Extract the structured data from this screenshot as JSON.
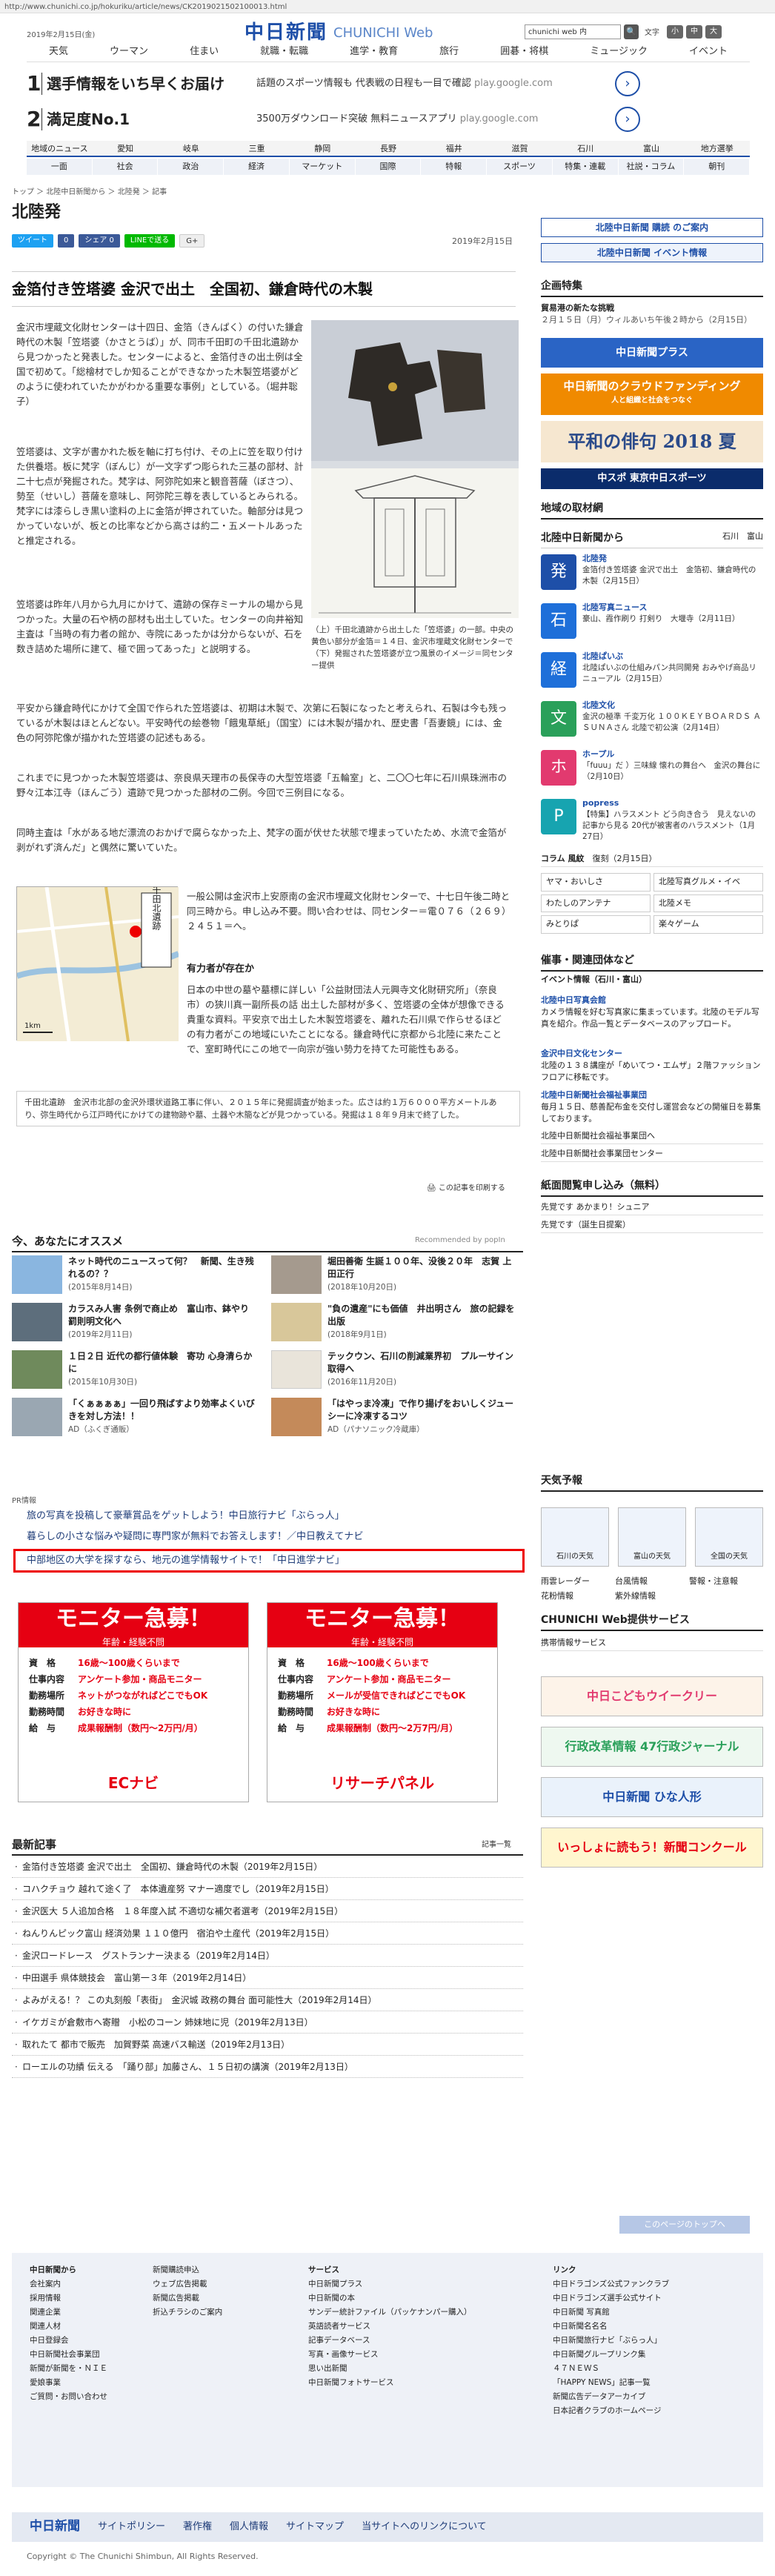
{
  "url": "http://www.chunichi.co.jp/hokuriku/article/news/CK2019021502100013.html",
  "top_date": "2019年2月15日(金)",
  "logo": {
    "main": "中日新聞",
    "sub": "CHUNICHI Web"
  },
  "search": {
    "value": "chunichi web 内",
    "button": "🔍"
  },
  "font_size": {
    "label": "文字",
    "btn_small": "小",
    "btn_mid": "中",
    "btn_large": "大"
  },
  "topnav": [
    "天気",
    "ウーマン",
    "住まい",
    "就職・転職",
    "進学・教育",
    "旅行",
    "囲碁・将棋",
    "ミュージック",
    "イベント"
  ],
  "ads": [
    {
      "num": "1",
      "title": "選手情報をいち早くお届け",
      "desc": "話題のスポーツ情報も 代表戦の日程も一目で確認",
      "src": "play.google.com"
    },
    {
      "num": "2",
      "title": "満足度No.1",
      "desc": "3500万ダウンロード突破 無料ニュースアプリ",
      "src": "play.google.com"
    }
  ],
  "regnav": [
    "地域のニュース",
    "愛知",
    "岐阜",
    "三重",
    "静岡",
    "長野",
    "福井",
    "滋賀",
    "石川",
    "富山",
    "地方選挙"
  ],
  "catnav": [
    "一面",
    "社会",
    "政治",
    "経済",
    "マーケット",
    "国際",
    "特報",
    "スポーツ",
    "特集・連載",
    "社説・コラム",
    "朝刊"
  ],
  "breadcrumb": "トップ ＞ 北陸中日新聞から ＞ 北陸発 ＞ 記事",
  "section_title": "北陸発",
  "share": {
    "tweet": "ツイート",
    "like": "0",
    "share": "シェア 0",
    "line": "LINEで送る",
    "gplus": "G+"
  },
  "article_date": "2019年2月15日",
  "headline": "金箔付き笠塔婆 金沢で出土　全国初、鎌倉時代の木製",
  "paragraphs": [
    "金沢市埋蔵文化財センターは十四日、金箔（きんぱく）の付いた鎌倉時代の木製「笠塔婆（かさとうば）」が、同市千田町の千田北遺跡から見つかったと発表した。センターによると、金箔付きの出土例は全国で初めて。「総檜材でしか知ることができなかった木製笠塔婆がどのように使われていたかがわかる重要な事例」としている。（堀井聡子）",
    "笠塔婆は、文字が書かれた板を軸に打ち付け、その上に笠を取り付けた供養塔。板に梵字（ぼんじ）が一文字ずつ彫られた三基の部材、計二十七点が発掘された。梵字は、阿弥陀如来と観音菩薩（ぼさつ）、勢至（せいし）菩薩を意味し、阿弥陀三尊を表しているとみられる。梵字には漆らしき黒い塗料の上に金箔が押されていた。軸部分は見つかっていないが、板との比率などから高さは約二・五メートルあったと推定される。",
    "笠塔婆は昨年八月から九月にかけて、遺跡の保存ミーナルの場から見つかった。大量の石や柄の部材も出土していた。センターの向井裕知主査は「当時の有力者の館か、寺院にあったかは分からないが、石を数き詰めた場所に建て、極で囲ってあった」と説明する。",
    "平安から鎌倉時代にかけて全国で作られた笠塔婆は、初期は木製で、次第に石製になったと考えられ、石製は今も残っているが木製はほとんどない。平安時代の絵巻物「餓鬼草紙」（国宝）には木製が描かれ、歴史書「吾妻鏡」には、金色の阿弥陀像が描かれた笠塔婆の記述もある。",
    "これまでに見つかった木製笠塔婆は、奈良県天理市の長保寺の大型笠塔婆「五輪室」と、二〇〇七年に石川県珠洲市の野々江本江寺（ほんごう）遺跡で見つかった部材の二例。今回で三例目になる。",
    "同時主査は「水がある地だ漂流のおかげで腐らなかった上、梵字の面が伏せた状態で埋まっていたため、水流で金箔が剥がれず済んだ」と偶然に驚いていた。"
  ],
  "caption": "（上）千田北遺跡から出土した「笠塔婆」の一部。中央の黄色い部分が金箔＝１４日、金沢市埋蔵文化財センターで（下）発掘された笠塔婆が立つ風景のイメージ＝同センター提供",
  "map": {
    "label": "千田北遺跡",
    "scale": "1km"
  },
  "exhibit": "一般公開は金沢市上安原南の金沢市埋蔵文化財センターで、十七日午後二時と同三時から。申し込み不要。問い合わせは、同センター＝電０７６（２６９）２４５１＝へ。",
  "expert_title": "有力者が存在か",
  "expert": "日本の中世の墓や墓標に詳しい「公益財団法人元興寺文化財研究所」（奈良市）の狭川真一副所長の話 出土した部材が多く、笠塔婆の全体が想像できる貴重な資料。平安京で出土した木製笠塔婆を、離れた石川県で作らせるほどの有力者がこの地域にいたことになる。鎌倉時代に京都から北陸に来たことで、室町時代にこの地で一向宗が強い勢力を持てた可能性もある。",
  "note": "千田北遺跡　金沢市北部の金沢外環状道路工事に伴い、２０１５年に発掘調査が始まった。広さは約１万６０００平方メートルあり、弥生時代から江戸時代にかけての建物跡や墓、土器や木簡などが見つかっている。発掘は１８年９月末で終了した。",
  "clip": "この記事を印刷する",
  "recommend": {
    "title": "今、あなたにオススメ",
    "poplin": "Recommended by popIn",
    "items": [
      {
        "text": "ネット時代のニュースって何？　新聞、生き残れるの？？",
        "date": "(2015年8月14日)"
      },
      {
        "text": "堀田善衛 生誕１００年、没後２０年　志賀 上田正行",
        "date": "(2018年10月20日)"
      },
      {
        "text": "カラスみ人害 条例で商止め　富山市、鉢やり 罰則明文化へ",
        "date": "(2019年2月11日)"
      },
      {
        "text": "\"負の遺産\"にも価値　井出明さん　旅の記録を出版",
        "date": "(2018年9月1日)"
      },
      {
        "text": "１日２日 近代の都行値体験　寄功 心身清らかに",
        "date": "(2015年10月30日)"
      },
      {
        "text": "テックウン、石川の削減業界初　プルーサイン取得へ",
        "date": "(2016年11月20日)"
      },
      {
        "text": "「くぁぁぁぁ」一回り飛ばすより効率よくいびきを対し方法！！",
        "date": "AD（ふくぎ通販）"
      },
      {
        "text": "「はやっま冷凍」で作り揚げをおいしくジューシーに冷凍するコツ",
        "date": "AD（パナソニック冷蔵庫）"
      }
    ]
  },
  "pr": {
    "label": "PR情報",
    "items": [
      "旅の写真を投稿して豪華賞品をゲットしよう！中日旅行ナビ「ぶらっ人」",
      "暮らしの小さな悩みや疑問に専門家が無料でお答えします！／中日教えてナビ",
      "中部地区の大学を探すなら、地元の進学情報サイトで！「中日進学ナビ」"
    ]
  },
  "monitors": [
    {
      "head": "モニター急募！",
      "sub": "年齢・経験不問",
      "r1k": "資　格",
      "r1v": "16歳〜100歳くらいまで",
      "r2k": "仕事内容",
      "r2v": "アンケート参加・商品モニター",
      "r3k": "勤務場所",
      "r3v": "ネットがつながればどこでもOK",
      "r4k": "勤務時間",
      "r4v": "お好きな時に",
      "r5k": "給　与",
      "r5v": "成果報酬制（数円〜2万円/月）",
      "brand": "ECナビ"
    },
    {
      "head": "モニター急募！",
      "sub": "年齢・経験不問",
      "r1k": "資　格",
      "r1v": "16歳〜100歳くらいまで",
      "r2k": "仕事内容",
      "r2v": "アンケート参加・商品モニター",
      "r3k": "勤務場所",
      "r3v": "メールが受信できればどこでもOK",
      "r4k": "勤務時間",
      "r4v": "お好きな時に",
      "r5k": "給　与",
      "r5v": "成果報酬制（数円〜2万7円/月）",
      "brand": "リサーチパネル"
    }
  ],
  "latest": {
    "title": "最新記事",
    "list_link": "記事一覧",
    "items": [
      "金箔付き笠塔婆 金沢で出土　全国初、鎌倉時代の木製（2019年2月15日）",
      "コハクチョウ 越れて途く了　本体遺産努 マナー適度でし（2019年2月15日）",
      "金沢医大 ５人追加合格　１８年度入試 不適切な補欠者選考（2019年2月15日）",
      "ねんりんピック富山 経済効果 １１０億円　宿泊や土産代（2019年2月15日）",
      "金沢ロードレース　グストランナー決まる（2019年2月14日）",
      "中田選手 県体競技会　富山第一３年（2019年2月14日）",
      "よみがえる！？ この丸刻般「表街」　金沢城 政務の舞台 面可能性大（2019年2月14日）",
      "イケガミが倉敷市へ寄贈　小松のコーン 姉妹地に児（2019年2月13日）",
      "取れたて 都市で販売　加賀野菜 高速バス輸送（2019年2月13日）",
      "ローエルの功績 伝える　「踊り部」加藤さん、１５日初の講演（2019年2月13日）"
    ]
  },
  "side": {
    "subscribe": "北陸中日新聞 購読 のご案内",
    "event": "北陸中日新聞 イベント情報",
    "kikaku_title": "企画特集",
    "kikaku1_title": "貿易港の新たな挑戦",
    "kikaku1_date": "２月１５日（月）ウィルあいち午後２時から（2月15日）",
    "cf_banner": "中日新聞のクラウドファンディング",
    "cf_sub": "人と組織と社会をつなぐ",
    "haiku_banner": "平和の俳句 2018 夏",
    "chusupo": "中スポ 東京中日スポーツ",
    "local_title": "地域の取材網",
    "hokuriku_from": "北陸中日新聞から",
    "hokuriku_links": "石川　富山",
    "news": [
      {
        "icon": "発",
        "color": "#1e4fa8",
        "title": "北陸発",
        "desc": "金箔付き笠塔婆 金沢で出土　金箔初、鎌倉時代の木製（2月15日）"
      },
      {
        "icon": "石",
        "color": "#1e6fd9",
        "title": "北陸写真ニュース",
        "desc": "豪山、霞作刷り 打剣り　大堰寺（2月11日）"
      },
      {
        "icon": "経",
        "color": "#1e6fd9",
        "title": "北陸ぱいぶ",
        "desc": "北陸ぱいぶの仕組みパン共同開発 おみやげ商品リニューアル（2月15日）"
      },
      {
        "icon": "文",
        "color": "#2aa05a",
        "title": "北陸文化",
        "desc": "金沢の極準 千変万化 １００ＫＥＹＢＯＡＲＤＳ ＡＳＵＮＡさん 北陸で初公演（2月14日）"
      },
      {
        "icon": "ホ",
        "color": "#e23a6f",
        "title": "ホープル",
        "desc": "「fuuu」だ ）三味線 懐れの舞台へ　金沢の舞台に（2月10日）"
      },
      {
        "icon": "P",
        "color": "#17a4b0",
        "title": "popress",
        "desc": "【特集】ハラスメント どう向き合う　見えないの記事から見る 20代が被害者のハラスメント（1月27日）"
      }
    ],
    "column_title": "コラム 風紋",
    "column_date": "復刻（2月15日）",
    "grid": [
      "ヤマ・おいしさ",
      "北陸写真グルメ・イベ",
      "わたしのアンテナ",
      "北陸メモ",
      "みとりぱ",
      "楽々ゲーム"
    ],
    "event_title": "催事・関連団体など",
    "event_sub": "イベント情報（石川・富山）",
    "event1_title": "北陸中日写真会館",
    "event1_desc": "カメラ情報を好む写真家に集まっています。北陸のモデル写真を紹介。作品一覧とデータベースのアップロード。",
    "event2_title": "金沢中日文化センター",
    "event2_desc": "北陸の１３８講座が「めいてつ・エムザ」２階ファッションフロアに移転です。",
    "event3_title": "北陸中日新聞社会福祉事業団",
    "event3_desc": "毎月１５日、慈善配布金を交付し運営会などの開催日を募集しております。",
    "link1": "北陸中日新聞社会福祉事業団へ",
    "link2": "北陸中日新聞社会事業団センター",
    "shiki_title": "紙面閲覧申し込み（無料）",
    "shiki1": "先覚です あかまり！シュニア",
    "shiki2": "先覚です（誕生日提案）",
    "weather_title": "天気予報",
    "weather": [
      "石川の天気",
      "富山の天気",
      "全国の天気"
    ],
    "weather_links": [
      "雨雲レーダー",
      "台風情報",
      "警報・注意報",
      "花粉情報",
      "紫外線情報"
    ],
    "web_title": "CHUNICHI Web提供サービス",
    "web1": "携帯情報サービス",
    "banners": [
      "中日こどもウイークリー",
      "行政改革情報 47行政ジャーナル",
      "中日新聞 ひな人形",
      "いっしょに読もう！新聞コンクール"
    ]
  },
  "pagetop": "このページのトップへ",
  "footer": {
    "col1": [
      "中日新聞から",
      "会社案内",
      "採用情報",
      "関連企業",
      "関連人材",
      "中日登録会",
      "中日新聞社会事業団",
      "新聞が新聞を・ＮＩＥ",
      "愛娘事業",
      "ご質問・お問い合わせ"
    ],
    "col2": [
      "",
      "",
      "新聞購読申込",
      "ウェブ広告掲載",
      "新聞広告掲載",
      "折込チラシのご案内"
    ],
    "col3": [
      "サービス",
      "中日新聞プラス",
      "中日新聞の本",
      "サンデー統計ファイル（パッケナンパー購入）",
      "英語読者サービス",
      "記事データベース",
      "写真・画像サービス",
      "思い出新聞",
      "中日新聞フォトサービス"
    ],
    "col4": [
      "リンク",
      "中日ドラゴンズ公式ファンクラブ",
      "中日ドラゴンズ選手公式サイト",
      "中日新聞 写真館",
      "中日新聞名名名",
      "中日新聞旅行ナビ「ぶらっ人」",
      "中日新聞グループリンク集",
      "４７ＮＥＷＳ",
      "「HAPPY NEWS」記事一覧",
      "新聞広告データアーカイブ",
      "日本記者クラブのホームページ"
    ]
  },
  "footer_bar": {
    "logo": "中日新聞",
    "links": [
      "サイトポリシー",
      "著作権",
      "個人情報",
      "サイトマップ",
      "当サイトへのリンクについて"
    ]
  },
  "copyright": "Copyright © The Chunichi Shimbun, All Rights Reserved.",
  "colors": {
    "brand": "#1e4fa8",
    "red": "#e60012"
  }
}
